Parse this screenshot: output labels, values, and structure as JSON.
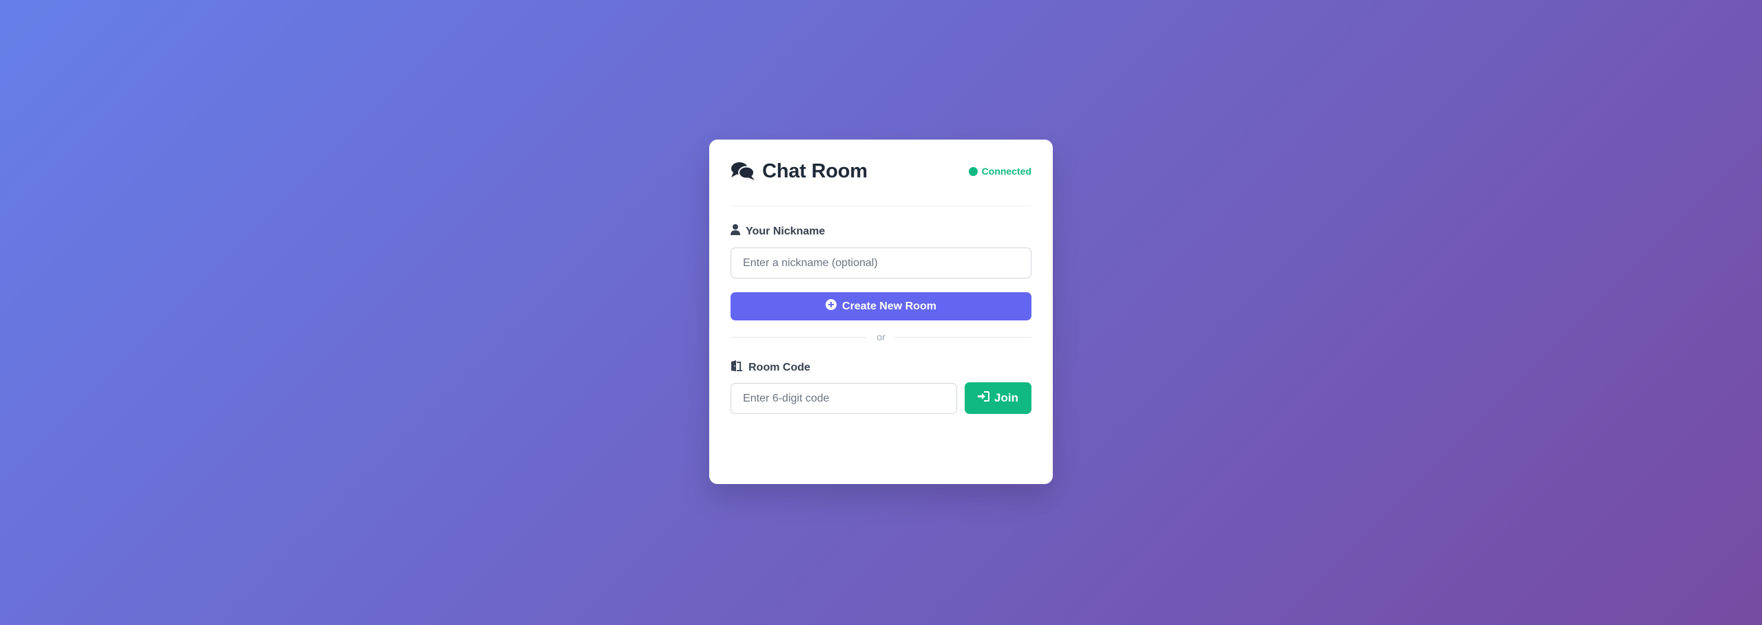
{
  "header": {
    "title": "Chat Room",
    "title_icon": "comments-icon",
    "status_label": "Connected",
    "status_color": "#10b981"
  },
  "nickname": {
    "label": "Your Nickname",
    "icon": "user-icon",
    "value": "",
    "placeholder": "Enter a nickname (optional)"
  },
  "create": {
    "label": "Create New Room",
    "icon": "plus-circle-icon",
    "color": "#6366f1"
  },
  "divider": {
    "label": "or"
  },
  "room": {
    "label": "Room Code",
    "icon": "door-open-icon",
    "value": "",
    "placeholder": "Enter 6-digit code",
    "join_label": "Join",
    "join_icon": "sign-in-icon",
    "join_color": "#10b981"
  },
  "theme": {
    "background_start": "#667eea",
    "background_end": "#764ba2"
  }
}
